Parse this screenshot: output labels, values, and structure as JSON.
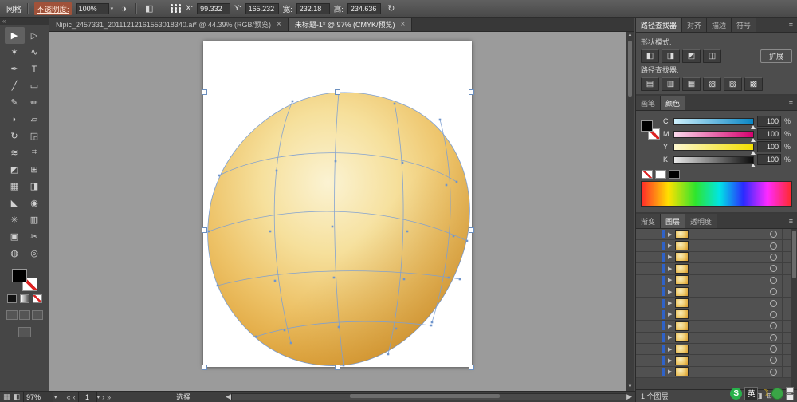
{
  "icons": {
    "chevron_down": "▾",
    "scroll_up": "▲",
    "scroll_down": "▼",
    "scroll_left": "◀",
    "scroll_right": "▶",
    "nav_first": "«",
    "nav_prev": "‹",
    "nav_next": "›",
    "nav_last": "»",
    "panel_menu": "≡",
    "collapse": "«",
    "recolor": "◑",
    "transform": "↻",
    "status_grid": "▦",
    "status_doc": "◧"
  },
  "control_bar": {
    "selection_label": "网格",
    "opacity_label": "不透明度:",
    "opacity_value": "100%",
    "fields": {
      "x_label": "X:",
      "x_value": "99.332",
      "y_label": "Y:",
      "y_value": "165.232",
      "w_label": "宽:",
      "w_value": "232.18",
      "h_label": "高:",
      "h_value": "234.636"
    }
  },
  "doc_tabs": [
    {
      "label": "Nipic_2457331_20111212161553018340.ai* @ 44.39% (RGB/预览)",
      "close": "×",
      "active": false
    },
    {
      "label": "未标题-1* @ 97% (CMYK/预览)",
      "close": "×",
      "active": true
    }
  ],
  "toolbar": {
    "tools": [
      {
        "name": "selection-tool",
        "glyph": "▶"
      },
      {
        "name": "direct-selection-tool",
        "glyph": "▷"
      },
      {
        "name": "magic-wand-tool",
        "glyph": "✶"
      },
      {
        "name": "lasso-tool",
        "glyph": "∿"
      },
      {
        "name": "pen-tool",
        "glyph": "✒"
      },
      {
        "name": "type-tool",
        "glyph": "T"
      },
      {
        "name": "line-segment-tool",
        "glyph": "╱"
      },
      {
        "name": "rectangle-tool",
        "glyph": "▭"
      },
      {
        "name": "paintbrush-tool",
        "glyph": "✎"
      },
      {
        "name": "pencil-tool",
        "glyph": "✏"
      },
      {
        "name": "blob-brush-tool",
        "glyph": "◗"
      },
      {
        "name": "eraser-tool",
        "glyph": "▱"
      },
      {
        "name": "rotate-tool",
        "glyph": "↻"
      },
      {
        "name": "scale-tool",
        "glyph": "◲"
      },
      {
        "name": "width-tool",
        "glyph": "≋"
      },
      {
        "name": "free-transform-tool",
        "glyph": "⌗"
      },
      {
        "name": "shape-builder-tool",
        "glyph": "◩"
      },
      {
        "name": "perspective-grid-tool",
        "glyph": "⊞"
      },
      {
        "name": "mesh-tool",
        "glyph": "▦"
      },
      {
        "name": "gradient-tool",
        "glyph": "◨"
      },
      {
        "name": "eyedropper-tool",
        "glyph": "◣"
      },
      {
        "name": "blend-tool",
        "glyph": "◉"
      },
      {
        "name": "symbol-sprayer-tool",
        "glyph": "✳"
      },
      {
        "name": "column-graph-tool",
        "glyph": "▥"
      },
      {
        "name": "artboard-tool",
        "glyph": "▣"
      },
      {
        "name": "slice-tool",
        "glyph": "✂"
      },
      {
        "name": "hand-tool",
        "glyph": "◍"
      },
      {
        "name": "zoom-tool",
        "glyph": "◎"
      }
    ]
  },
  "pathfinder_panel": {
    "tabs": [
      {
        "label": "路径查找器",
        "active": true
      },
      {
        "label": "对齐",
        "active": false
      },
      {
        "label": "描边",
        "active": false
      },
      {
        "label": "符号",
        "active": false
      }
    ],
    "shape_mode_label": "形状模式:",
    "shape_mode_buttons": [
      {
        "name": "unite-icon",
        "glyph": "◧"
      },
      {
        "name": "minus-front-icon",
        "glyph": "◨"
      },
      {
        "name": "intersect-icon",
        "glyph": "◩"
      },
      {
        "name": "exclude-icon",
        "glyph": "◫"
      }
    ],
    "expand_label": "扩展",
    "pathfinder_label": "路径查找器:",
    "pathfinder_buttons": [
      {
        "name": "divide-icon",
        "glyph": "▤"
      },
      {
        "name": "trim-icon",
        "glyph": "▥"
      },
      {
        "name": "merge-icon",
        "glyph": "▦"
      },
      {
        "name": "crop-icon",
        "glyph": "▧"
      },
      {
        "name": "outline-icon",
        "glyph": "▨"
      },
      {
        "name": "minus-back-icon",
        "glyph": "▩"
      }
    ]
  },
  "color_panel": {
    "tabs": [
      {
        "label": "画笔",
        "active": false
      },
      {
        "label": "颜色",
        "active": true
      }
    ],
    "sliders": [
      {
        "label": "C",
        "value": "100",
        "suffix": "%"
      },
      {
        "label": "M",
        "value": "100",
        "suffix": "%"
      },
      {
        "label": "Y",
        "value": "100",
        "suffix": "%"
      },
      {
        "label": "K",
        "value": "100",
        "suffix": "%"
      }
    ]
  },
  "layers_panel": {
    "tabs": [
      {
        "label": "渐变",
        "active": false
      },
      {
        "label": "图层",
        "active": true
      },
      {
        "label": "透明度",
        "active": false
      }
    ],
    "rows": 13,
    "footer_label": "1 个图层",
    "footer_icons": [
      {
        "name": "make-clipping-mask-icon",
        "glyph": "◨"
      },
      {
        "name": "new-sublayer-icon",
        "glyph": "⊞"
      },
      {
        "name": "new-layer-icon",
        "glyph": "⊡"
      },
      {
        "name": "delete-layer-icon",
        "glyph": "⊟"
      }
    ]
  },
  "status_bar": {
    "zoom_value": "97%",
    "artboard_value": "1",
    "tool_hint": "选择"
  },
  "ime_bar": {
    "sogou_label": "S",
    "lang_label": "英"
  },
  "colors": {
    "mesh_line": "#7d9fd2",
    "gold_light": "#fbf3d3",
    "gold_dark": "#d3922a",
    "accent_blue": "#2f62c8"
  }
}
